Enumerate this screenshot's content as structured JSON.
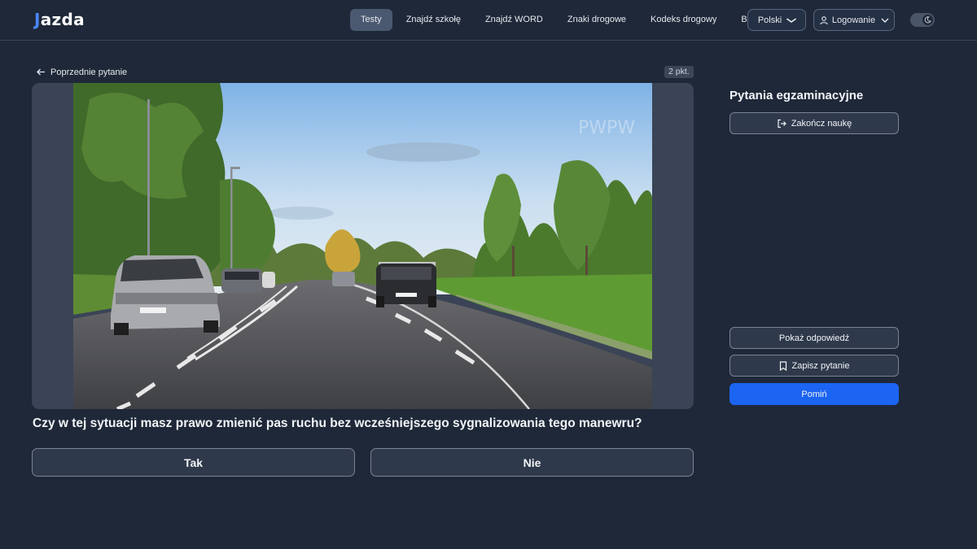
{
  "brand": {
    "logo_j": "J",
    "logo_rest": "azda",
    "accent": "#4a86f7"
  },
  "nav": {
    "links": [
      {
        "label": "Testy",
        "active": true
      },
      {
        "label": "Znajdź szkołę",
        "active": false
      },
      {
        "label": "Znajdź WORD",
        "active": false
      },
      {
        "label": "Znaki drogowe",
        "active": false
      },
      {
        "label": "Kodeks drogowy",
        "active": false
      },
      {
        "label": "Blog",
        "active": false
      }
    ],
    "language": "Polski",
    "login": "Logowanie",
    "theme_icon": "moon-icon"
  },
  "question": {
    "back_label": "Poprzednie pytanie",
    "points": "2 pkt.",
    "image_watermark": "PWPW",
    "text": "Czy w tej sytuacji masz prawo zmienić pas ruchu bez wcześniejszego sygnalizowania tego manewru?",
    "answers": {
      "yes": "Tak",
      "no": "Nie"
    }
  },
  "sidebar": {
    "title": "Pytania egzaminacyjne",
    "end_label": "Zakończ naukę",
    "show_answer_label": "Pokaż odpowiedź",
    "save_label": "Zapisz pytanie",
    "skip_label": "Pomiń",
    "skip_color": "#1c64f2"
  }
}
